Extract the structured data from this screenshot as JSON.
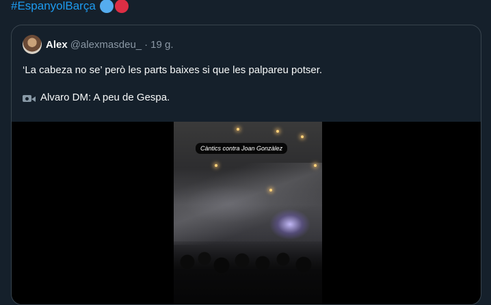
{
  "tweet": {
    "hashtag": "#EspanyolBarça"
  },
  "quote": {
    "author_name": "Alex",
    "author_handle": "@alexmasdeu_",
    "separator": "·",
    "timestamp": "19 g.",
    "text_line1": "‘La cabeza no se’ però les parts baixes si que les palpareu potser.",
    "text_line2": "Alvaro DM: A peu de Gespa.",
    "media": {
      "overlay_caption": "Càntics contra Joan Gonzàlez"
    }
  },
  "icons": {
    "emoji_1": "blue-circle-icon",
    "emoji_2": "red-circle-icon",
    "camera": "movie-camera-icon"
  },
  "colors": {
    "background": "#15202b",
    "link": "#1d9bf0",
    "muted": "#8b98a5",
    "border": "#38444d"
  }
}
